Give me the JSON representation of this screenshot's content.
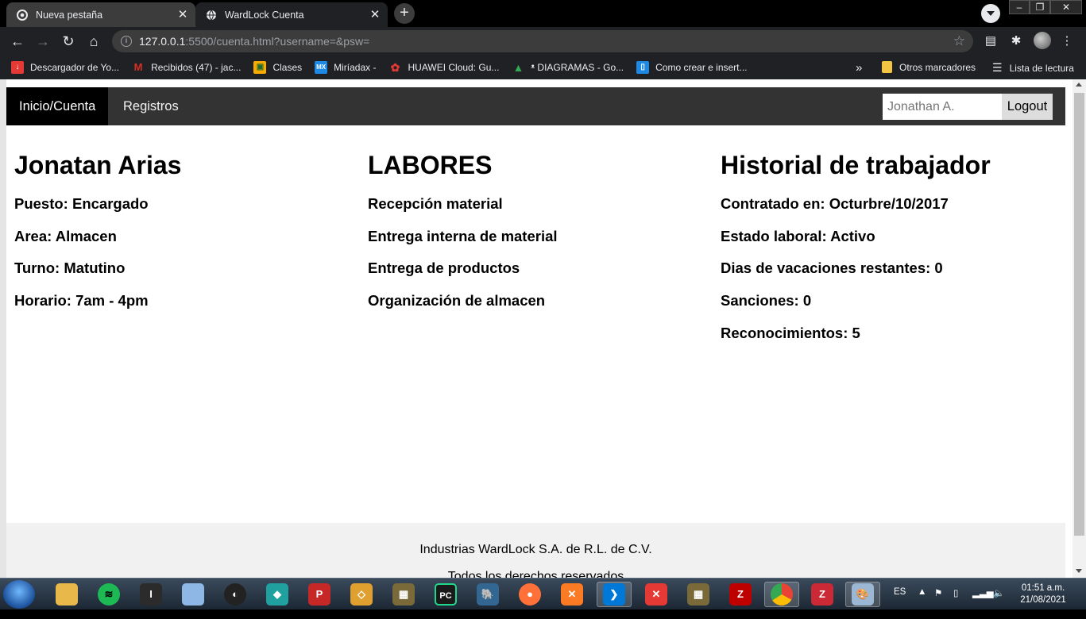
{
  "browser": {
    "tabs": [
      {
        "title": "Nueva pestaña",
        "active": false
      },
      {
        "title": "WardLock Cuenta",
        "active": true
      }
    ],
    "url_host": "127.0.0.1",
    "url_rest": ":5500/cuenta.html?username=&psw=",
    "bookmarks": [
      {
        "label": "Descargador de Yo...",
        "icon": "download-icon",
        "color": "#e53935"
      },
      {
        "label": "Recibidos (47) - jac...",
        "icon": "gmail-icon",
        "color": "#d93025"
      },
      {
        "label": "Clases",
        "icon": "classroom-icon",
        "color": "#f9ab00"
      },
      {
        "label": "Miríadax -",
        "icon": "miriadax-icon",
        "color": "#1e88e5"
      },
      {
        "label": "HUAWEI Cloud: Gu...",
        "icon": "huawei-icon",
        "color": "#e53935"
      },
      {
        "label": "ᵜ DIAGRAMAS - Go...",
        "icon": "drive-icon",
        "color": "#34a853"
      },
      {
        "label": "Como crear e insert...",
        "icon": "bookmark-site-icon",
        "color": "#1e88e5"
      }
    ],
    "bookmarks_overflow": "»",
    "other_bookmarks": "Otros marcadores",
    "reading_list": "Lista de lectura"
  },
  "nav": {
    "links": [
      "Inicio/Cuenta",
      "Registros"
    ],
    "user_placeholder": "Jonathan A.",
    "logout_label": "Logout"
  },
  "profile": {
    "name": "Jonatan Arias",
    "items": [
      "Puesto: Encargado",
      "Area: Almacen",
      "Turno: Matutino",
      "Horario: 7am - 4pm"
    ]
  },
  "labores": {
    "title": "LABORES",
    "items": [
      "Recepción material",
      "Entrega interna de material",
      "Entrega de productos",
      "Organización de almacen"
    ]
  },
  "historial": {
    "title": "Historial de trabajador",
    "items": [
      "Contratado en: Octurbre/10/2017",
      "Estado laboral: Activo",
      "Dias de vacaciones restantes: 0",
      "Sanciones: 0",
      "Reconocimientos: 5"
    ]
  },
  "footer": {
    "line1": "Industrias WardLock S.A. de R.L. de C.V.",
    "line2": "Todos los derechos reservados"
  },
  "taskbar": {
    "language": "ES",
    "time": "01:51 a.m.",
    "date": "21/08/2021"
  }
}
